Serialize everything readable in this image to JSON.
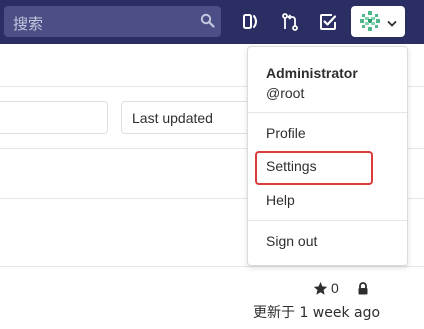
{
  "navbar": {
    "search_placeholder": "搜索",
    "icons": [
      "search-icon",
      "issues-icon",
      "merge-request-icon",
      "todo-icon",
      "user-avatar-icon",
      "chevron-down-icon"
    ]
  },
  "page": {
    "sort_label": "Last updated",
    "project": {
      "star_count": "0",
      "updated": "更新于 1 week ago"
    }
  },
  "dropdown": {
    "name": "Administrator",
    "username": "@root",
    "items": [
      "Profile",
      "Settings",
      "Help",
      "Sign out"
    ],
    "highlighted_item": "Settings",
    "highlight_color": "#dd3a3a"
  },
  "colors": {
    "navbar_bg": "#2b2e62",
    "search_bg": "#4b4f85",
    "text": "#2e2e2e"
  }
}
